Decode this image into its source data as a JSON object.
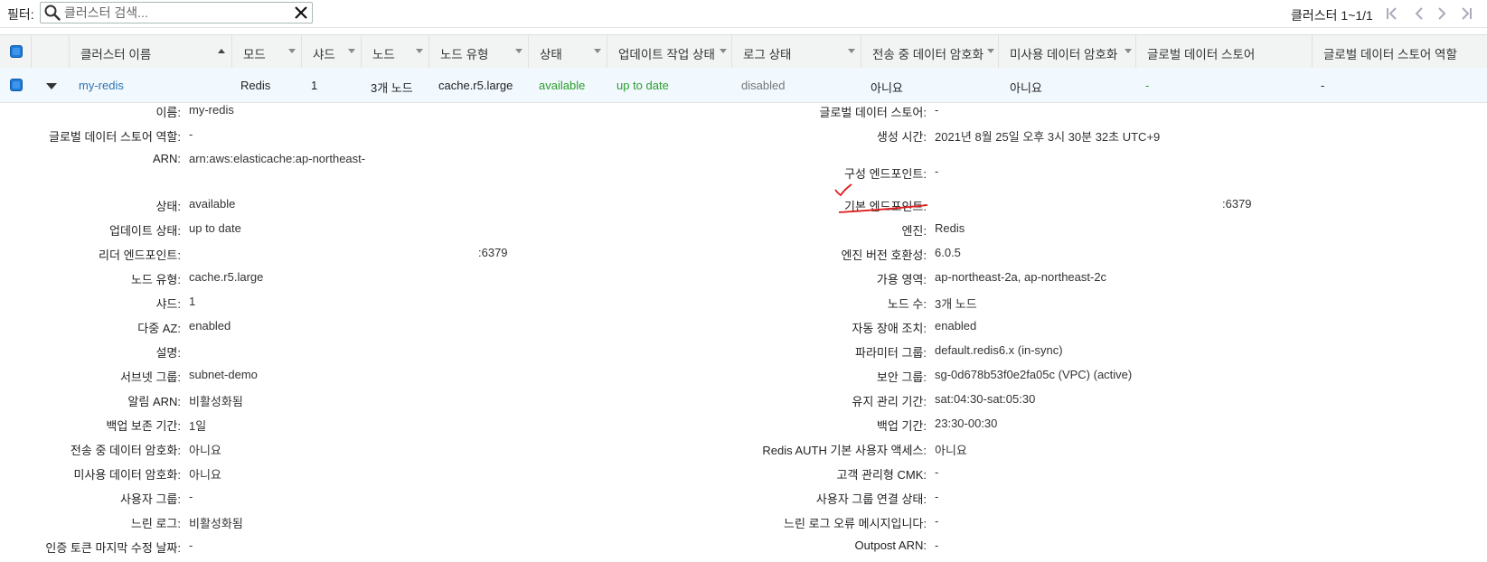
{
  "filter": {
    "label": "필터:",
    "placeholder": "클러스터 검색...",
    "value": ""
  },
  "pager": {
    "text": "클러스터 1~1/1"
  },
  "icons": {
    "search": "search-icon",
    "clear": "close-icon",
    "first": "first-page-icon",
    "prev": "prev-page-icon",
    "next": "next-page-icon",
    "last": "last-page-icon"
  },
  "columns": [
    "클러스터 이름",
    "모드",
    "샤드",
    "노드",
    "노드 유형",
    "상태",
    "업데이트 작업 상태",
    "로그 상태",
    "전송 중 데이터 암호화",
    "미사용 데이터 암호화",
    "글로벌 데이터 스토어",
    "글로벌 데이터 스토어 역할"
  ],
  "row": {
    "name": "my-redis",
    "mode": "Redis",
    "shards": "1",
    "nodes": "3개 노드",
    "node_type": "cache.r5.large",
    "status": "available",
    "update_status": "up to date",
    "log_status": "disabled",
    "transit_encryption": "아니요",
    "rest_encryption": "아니요",
    "global_store": "-",
    "global_store_role": "-"
  },
  "details_left": [
    {
      "label": "이름:",
      "value": "my-redis"
    },
    {
      "label": "글로벌 데이터 스토어 역할:",
      "value": "-"
    },
    {
      "label": "ARN:",
      "value": "arn:aws:elasticache:ap-northeast-"
    },
    {
      "label": "상태:",
      "value": "available"
    },
    {
      "label": "업데이트 상태:",
      "value": "up to date"
    },
    {
      "label": "리더 엔드포인트:",
      "value": ":6379"
    },
    {
      "label": "노드 유형:",
      "value": "cache.r5.large"
    },
    {
      "label": "샤드:",
      "value": "1"
    },
    {
      "label": "다중 AZ:",
      "value": "enabled"
    },
    {
      "label": "설명:",
      "value": ""
    },
    {
      "label": "서브넷 그룹:",
      "value": "subnet-demo"
    },
    {
      "label": "알림 ARN:",
      "value": "비활성화됨"
    },
    {
      "label": "백업 보존 기간:",
      "value": "1일"
    },
    {
      "label": "전송 중 데이터 암호화:",
      "value": "아니요"
    },
    {
      "label": "미사용 데이터 암호화:",
      "value": "아니요"
    },
    {
      "label": "사용자 그룹:",
      "value": "-"
    },
    {
      "label": "느린 로그:",
      "value": "비활성화됨"
    },
    {
      "label": "인증 토큰 마지막 수정 날짜:",
      "value": "-"
    }
  ],
  "details_right": [
    {
      "label": "글로벌 데이터 스토어:",
      "value": "-"
    },
    {
      "label": "생성 시간:",
      "value": "2021년 8월 25일 오후 3시 30분 32초 UTC+9"
    },
    {
      "label": "구성 엔드포인트:",
      "value": "-"
    },
    {
      "label": "기본 엔드포인트:",
      "value": ":6379"
    },
    {
      "label": "엔진:",
      "value": "Redis"
    },
    {
      "label": "엔진 버전 호환성:",
      "value": "6.0.5"
    },
    {
      "label": "가용 영역:",
      "value": "ap-northeast-2a, ap-northeast-2c"
    },
    {
      "label": "노드 수:",
      "value": "3개 노드"
    },
    {
      "label": "자동 장애 조치:",
      "value": "enabled"
    },
    {
      "label": "파라미터 그룹:",
      "value": "default.redis6.x (in-sync)"
    },
    {
      "label": "보안 그룹:",
      "value": "sg-0d678b53f0e2fa05c (VPC) (active)"
    },
    {
      "label": "유지 관리 기간:",
      "value": "sat:04:30-sat:05:30"
    },
    {
      "label": "백업 기간:",
      "value": "23:30-00:30"
    },
    {
      "label": "Redis AUTH 기본 사용자 액세스:",
      "value": "아니요"
    },
    {
      "label": "고객 관리형 CMK:",
      "value": "-"
    },
    {
      "label": "사용자 그룹 연결 상태:",
      "value": "-"
    },
    {
      "label": "느린 로그 오류 메시지입니다:",
      "value": "-"
    },
    {
      "label": "Outpost ARN:",
      "value": "-"
    }
  ]
}
